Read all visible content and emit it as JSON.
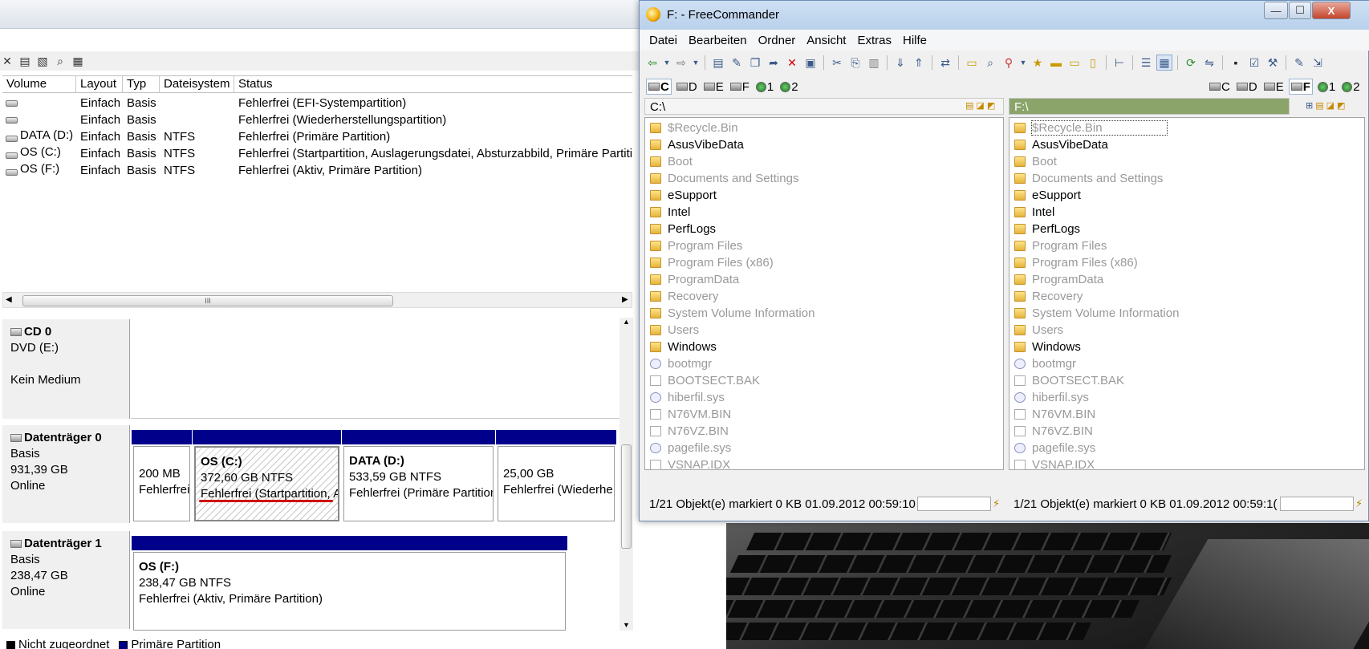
{
  "disk_management": {
    "table": {
      "headers": [
        "Volume",
        "Layout",
        "Typ",
        "Dateisystem",
        "Status"
      ],
      "rows": [
        {
          "volume": "",
          "layout": "Einfach",
          "typ": "Basis",
          "fs": "",
          "status": "Fehlerfrei (EFI-Systempartition)"
        },
        {
          "volume": "",
          "layout": "Einfach",
          "typ": "Basis",
          "fs": "",
          "status": "Fehlerfrei (Wiederherstellungspartition)"
        },
        {
          "volume": "DATA (D:)",
          "layout": "Einfach",
          "typ": "Basis",
          "fs": "NTFS",
          "status": "Fehlerfrei (Primäre Partition)"
        },
        {
          "volume": "OS (C:)",
          "layout": "Einfach",
          "typ": "Basis",
          "fs": "NTFS",
          "status": "Fehlerfrei (Startpartition, Auslagerungsdatei, Absturzabbild, Primäre Partiti"
        },
        {
          "volume": "OS (F:)",
          "layout": "Einfach",
          "typ": "Basis",
          "fs": "NTFS",
          "status": "Fehlerfrei (Aktiv, Primäre Partition)"
        }
      ]
    },
    "hscroll_grip": "III",
    "cd0": {
      "title": "CD 0",
      "line1": "DVD (E:)",
      "line2": "Kein Medium"
    },
    "disk0": {
      "title": "Datenträger 0",
      "type": "Basis",
      "size": "931,39 GB",
      "state": "Online",
      "partitions": [
        {
          "name": "",
          "size": "200 MB",
          "status": "Fehlerfrei"
        },
        {
          "name": "OS  (C:)",
          "size": "372,60 GB NTFS",
          "status": "Fehlerfrei (Startpartition, A"
        },
        {
          "name": "DATA  (D:)",
          "size": "533,59 GB NTFS",
          "status": "Fehlerfrei (Primäre Partition"
        },
        {
          "name": "",
          "size": "25,00 GB",
          "status": "Fehlerfrei (Wiederhe"
        }
      ]
    },
    "disk1": {
      "title": "Datenträger 1",
      "type": "Basis",
      "size": "238,47 GB",
      "state": "Online",
      "partition": {
        "name": "OS  (F:)",
        "size": "238,47 GB NTFS",
        "status": "Fehlerfrei (Aktiv, Primäre Partition)"
      }
    },
    "legend": [
      {
        "label": "Nicht zugeordnet",
        "color": "#000000"
      },
      {
        "label": "Primäre Partition",
        "color": "#00008b"
      }
    ]
  },
  "freecommander": {
    "title": "F: - FreeCommander",
    "window_buttons": {
      "minimize": "—",
      "maximize": "☐",
      "close": "X"
    },
    "menu": [
      "Datei",
      "Bearbeiten",
      "Ordner",
      "Ansicht",
      "Extras",
      "Hilfe"
    ],
    "left_drives": [
      "C",
      "D",
      "E",
      "F",
      "1",
      "2"
    ],
    "right_drives": [
      "C",
      "D",
      "E",
      "F",
      "1",
      "2"
    ],
    "left_panel": {
      "path": "C:\\",
      "status_text": "1/21 Objekt(e) markiert   0 KB   01.09.2012 00:59:10"
    },
    "right_panel": {
      "path": "F:\\",
      "status_text": "1/21 Objekt(e) markiert   0 KB   01.09.2012 00:59:1("
    },
    "files": [
      {
        "name": "$Recycle.Bin",
        "kind": "folder",
        "dim": true
      },
      {
        "name": "AsusVibeData",
        "kind": "folder",
        "dim": false
      },
      {
        "name": "Boot",
        "kind": "folder",
        "dim": true
      },
      {
        "name": "Documents and Settings",
        "kind": "link",
        "dim": true
      },
      {
        "name": "eSupport",
        "kind": "folder",
        "dim": false
      },
      {
        "name": "Intel",
        "kind": "folder",
        "dim": false
      },
      {
        "name": "PerfLogs",
        "kind": "folder",
        "dim": false
      },
      {
        "name": "Program Files",
        "kind": "folder",
        "dim": true
      },
      {
        "name": "Program Files (x86)",
        "kind": "folder",
        "dim": true
      },
      {
        "name": "ProgramData",
        "kind": "folder",
        "dim": true
      },
      {
        "name": "Recovery",
        "kind": "folder",
        "dim": true
      },
      {
        "name": "System Volume Information",
        "kind": "folder",
        "dim": true
      },
      {
        "name": "Users",
        "kind": "folder",
        "dim": true
      },
      {
        "name": "Windows",
        "kind": "folder",
        "dim": false
      },
      {
        "name": "bootmgr",
        "kind": "sys",
        "dim": true
      },
      {
        "name": "BOOTSECT.BAK",
        "kind": "file",
        "dim": true
      },
      {
        "name": "hiberfil.sys",
        "kind": "sys",
        "dim": true
      },
      {
        "name": "N76VM.BIN",
        "kind": "file",
        "dim": true
      },
      {
        "name": "N76VZ.BIN",
        "kind": "file",
        "dim": true
      },
      {
        "name": "pagefile.sys",
        "kind": "sys",
        "dim": true
      },
      {
        "name": "VSNAP.IDX",
        "kind": "file",
        "dim": true
      }
    ],
    "colors": {
      "left_path_bg": "#f5f5f5",
      "right_path_bg": "#8aa46a",
      "highlight_underline": "#d00000"
    }
  }
}
